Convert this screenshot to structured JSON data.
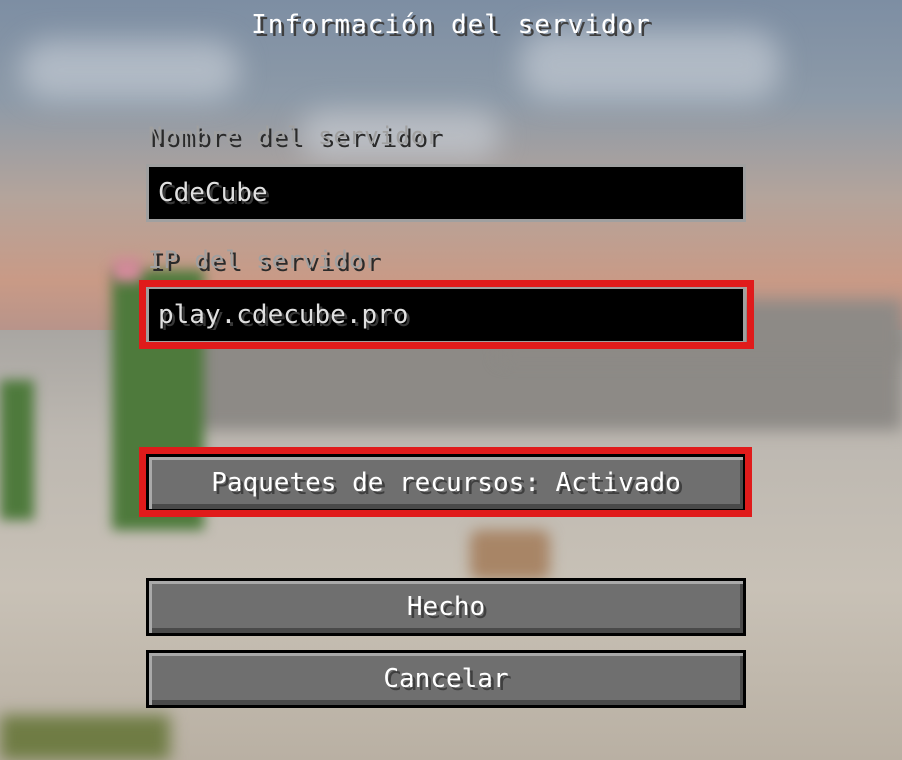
{
  "screen": {
    "title": "Información del servidor"
  },
  "form": {
    "server_name_label": "Nombre del servidor",
    "server_name_value": "CdeCube",
    "server_ip_label": "IP del servidor",
    "server_ip_value": "play.cdecube.pro"
  },
  "buttons": {
    "resource_packs_label": "Paquetes de recursos: Activado",
    "done_label": "Hecho",
    "cancel_label": "Cancelar"
  },
  "colors": {
    "highlight": "#e01b1b",
    "button_face": "#6f6f6f",
    "field_bg": "#000000",
    "label_text": "#a0a0a0"
  }
}
